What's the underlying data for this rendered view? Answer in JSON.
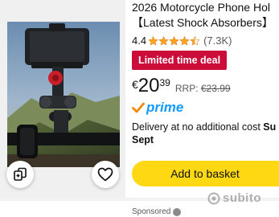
{
  "product": {
    "title": "2026 Motorcycle Phone Hol",
    "subtitle": "【Latest Shock Absorbers】",
    "rating_value": "4.4",
    "rating_stars": 4.4,
    "review_count": "(7.3K)",
    "deal_badge": "Limited time deal",
    "price_currency": "€",
    "price_whole": "20",
    "price_fraction": "39",
    "rrp_label": "RRP:",
    "rrp_price": "€23.99",
    "prime_label": "prime",
    "delivery_line1": "Delivery at no additional cost",
    "delivery_bold_tail": "Su",
    "delivery_line2": "Sept",
    "add_to_basket": "Add to basket",
    "wishlist_icon": "heart-icon",
    "compare_icon": "compare-icon"
  },
  "footer": {
    "sponsored": "Sponsored"
  },
  "watermark": {
    "text": "subito"
  },
  "colors": {
    "deal_badge": "#cc0c39",
    "stars": "#ffa41c",
    "prime": "#1399ff",
    "basket_button": "#ffd814"
  }
}
